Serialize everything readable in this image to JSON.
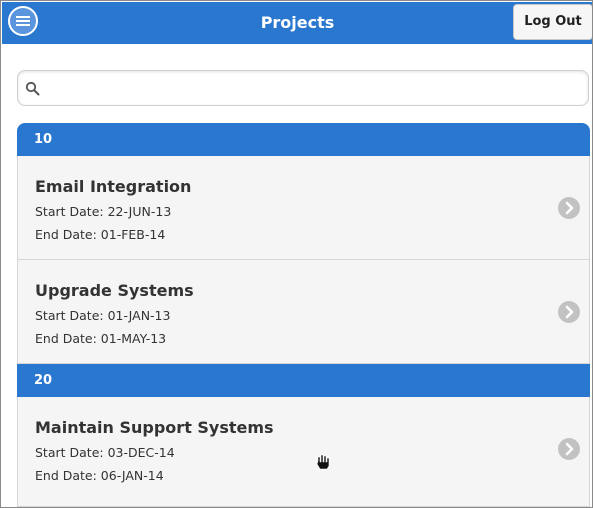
{
  "header": {
    "title": "Projects",
    "menu_icon": "hamburger-menu-icon",
    "logout_label": "Log Out",
    "background": "#2a77d0"
  },
  "search": {
    "placeholder": "",
    "value": "",
    "icon": "search-icon"
  },
  "groups": [
    {
      "label": "10",
      "items": [
        {
          "title": "Email Integration",
          "start": "Start Date: 22-JUN-13",
          "end": "End Date: 01-FEB-14"
        },
        {
          "title": "Upgrade Systems",
          "start": "Start Date: 01-JAN-13",
          "end": "End Date: 01-MAY-13"
        }
      ]
    },
    {
      "label": "20",
      "items": [
        {
          "title": "Maintain Support Systems",
          "start": "Start Date: 03-DEC-14",
          "end": "End Date: 06-JAN-14"
        }
      ]
    }
  ],
  "colors": {
    "accent": "#2a77d0",
    "item_background": "#f5f5f5",
    "chevron": "#c2c2c2"
  }
}
